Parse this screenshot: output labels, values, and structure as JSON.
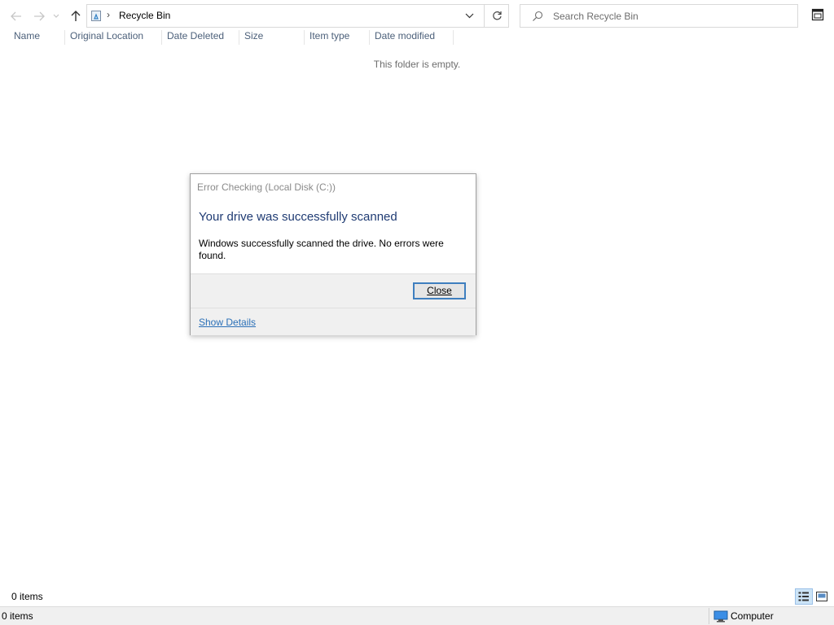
{
  "nav": {
    "back_icon": "arrow-left-icon",
    "forward_icon": "arrow-right-icon",
    "recent_icon": "chevron-down-icon",
    "up_icon": "arrow-up-icon"
  },
  "address": {
    "location_label": "Recycle Bin",
    "icon": "recycle-bin-icon",
    "refresh_icon": "refresh-icon"
  },
  "search": {
    "placeholder": "Search Recycle Bin",
    "icon": "search-icon"
  },
  "columns": [
    "Name",
    "Original Location",
    "Date Deleted",
    "Size",
    "Item type",
    "Date modified"
  ],
  "empty_message": "This folder is empty.",
  "dialog": {
    "title": "Error Checking (Local Disk (C:))",
    "heading": "Your drive was successfully scanned",
    "body": "Windows successfully scanned the drive. No errors were found.",
    "close_label": "Close",
    "details_link": "Show Details"
  },
  "pane_status": "0 items",
  "status_bar": {
    "items": "0 items",
    "location": "Computer"
  },
  "colors": {
    "accent": "#3f7fbf",
    "heading": "#1f3b73",
    "link": "#2a6fb7"
  }
}
